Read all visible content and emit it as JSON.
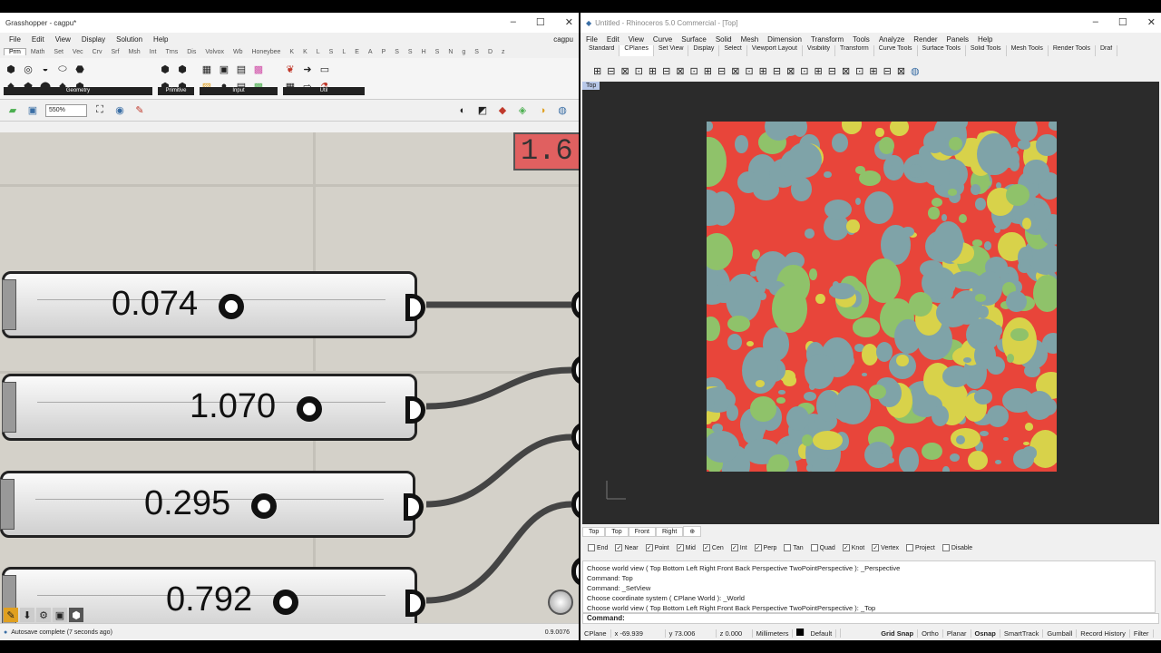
{
  "gh": {
    "title": "Grasshopper - cagpu*",
    "menu": [
      "File",
      "Edit",
      "View",
      "Display",
      "Solution",
      "Help"
    ],
    "doc_name": "cagpu",
    "tabs": [
      "Prm",
      "Math",
      "Set",
      "Vec",
      "Crv",
      "Srf",
      "Msh",
      "Int",
      "Trns",
      "Dis",
      "Volvox",
      "Wb",
      "Honeybee",
      "K",
      "K",
      "L",
      "S",
      "L",
      "E",
      "A",
      "P",
      "S",
      "S",
      "H",
      "S",
      "N",
      "g",
      "S",
      "D",
      "z"
    ],
    "groups": [
      "Geometry",
      "Primitive",
      "Input",
      "Util"
    ],
    "zoom": "550%",
    "panel_value": "1.6",
    "sliders": [
      {
        "value": "0.074"
      },
      {
        "value": "1.070"
      },
      {
        "value": "0.295"
      },
      {
        "value": "0.792"
      }
    ],
    "status": "Autosave complete (7 seconds ago)",
    "version": "0.9.0076"
  },
  "rh": {
    "title": "Untitled - Rhinoceros 5.0 Commercial - [Top]",
    "menu": [
      "File",
      "Edit",
      "View",
      "Curve",
      "Surface",
      "Solid",
      "Mesh",
      "Dimension",
      "Transform",
      "Tools",
      "Analyze",
      "Render",
      "Panels",
      "Help"
    ],
    "toolbar_tabs": [
      "Standard",
      "CPlanes",
      "Set View",
      "Display",
      "Select",
      "Viewport Layout",
      "Visibility",
      "Transform",
      "Curve Tools",
      "Surface Tools",
      "Solid Tools",
      "Mesh Tools",
      "Render Tools",
      "Draf"
    ],
    "active_view": "Top",
    "view_tabs": [
      "Top",
      "Top",
      "Front",
      "Right"
    ],
    "osnaps": [
      {
        "label": "End",
        "checked": false
      },
      {
        "label": "Near",
        "checked": true
      },
      {
        "label": "Point",
        "checked": true
      },
      {
        "label": "Mid",
        "checked": true
      },
      {
        "label": "Cen",
        "checked": true
      },
      {
        "label": "Int",
        "checked": true
      },
      {
        "label": "Perp",
        "checked": true
      },
      {
        "label": "Tan",
        "checked": false
      },
      {
        "label": "Quad",
        "checked": false
      },
      {
        "label": "Knot",
        "checked": true
      },
      {
        "label": "Vertex",
        "checked": true
      },
      {
        "label": "Project",
        "checked": false
      },
      {
        "label": "Disable",
        "checked": false
      }
    ],
    "command_history": [
      "Choose world view ( Top  Bottom  Left  Right  Front  Back  Perspective  TwoPointPerspective ): _Perspective",
      "Command: Top",
      "Command: _SetView",
      "Choose coordinate system ( CPlane  World ): _World",
      "Choose world view ( Top  Bottom  Left  Right  Front  Back  Perspective  TwoPointPerspective ): _Top"
    ],
    "command_prompt": "Command:",
    "status": {
      "cplane": "CPlane",
      "x": "x -69.939",
      "y": "y 73.006",
      "z": "z 0.000",
      "units": "Millimeters",
      "layer": "Default",
      "toggles": [
        "Grid Snap",
        "Ortho",
        "Planar",
        "Osnap",
        "SmartTrack",
        "Gumball",
        "Record History",
        "Filter"
      ]
    }
  },
  "colors": {
    "red": "#e8453a",
    "teal": "#7fa3a8",
    "yellow": "#d8d24a",
    "green": "#8fc26a"
  }
}
